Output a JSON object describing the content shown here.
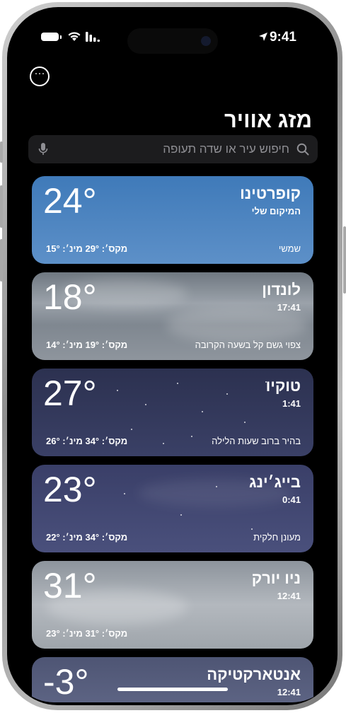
{
  "status_bar": {
    "time": "9:41"
  },
  "header": {
    "title": "מזג אוויר",
    "more_label": "···"
  },
  "search": {
    "placeholder": "חיפוש עיר או שדה תעופה"
  },
  "cities": [
    {
      "name": "קופרטינו",
      "subtitle": "המיקום שלי",
      "temp": "24°",
      "condition": "שמשי",
      "hi_lo": "מקס׳: 29°  מינ׳: 15°"
    },
    {
      "name": "לונדון",
      "subtitle": "17:41",
      "temp": "18°",
      "condition": "צפוי גשם קל בשעה הקרובה",
      "hi_lo": "מקס׳: 19°  מינ׳: 14°"
    },
    {
      "name": "טוקיו",
      "subtitle": "1:41",
      "temp": "27°",
      "condition": "בהיר ברוב שעות הלילה",
      "hi_lo": "מקס׳: 34°  מינ׳: 26°"
    },
    {
      "name": "בייג׳ינג",
      "subtitle": "0:41",
      "temp": "23°",
      "condition": "מעונן חלקית",
      "hi_lo": "מקס׳: 34°  מינ׳: 22°"
    },
    {
      "name": "ניו יורק",
      "subtitle": "12:41",
      "temp": "31°",
      "condition": "",
      "hi_lo": "מקס׳: 31°  מינ׳: 23°"
    },
    {
      "name": "אנטארקטיקה",
      "subtitle": "12:41",
      "temp": "-3°",
      "condition": "",
      "hi_lo": ""
    }
  ],
  "colors": {
    "sunny": "#4a84c1",
    "rain": "#8a9299",
    "night": "#333957",
    "cloudy_night": "#434874",
    "overcast": "#a8adb3",
    "snow": "#5d6483"
  }
}
